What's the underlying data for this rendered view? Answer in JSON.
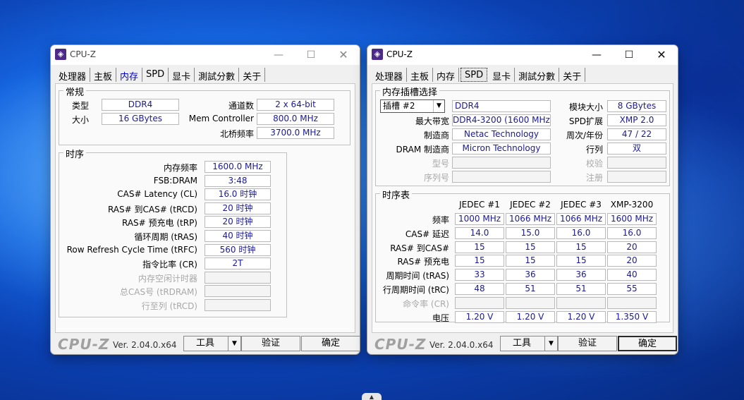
{
  "left": {
    "title": "CPU-Z",
    "tabs": [
      "处理器",
      "主板",
      "内存",
      "SPD",
      "显卡",
      "測試分數",
      "关于"
    ],
    "general": {
      "legend": "常规",
      "type_label": "类型",
      "type_value": "DDR4",
      "size_label": "大小",
      "size_value": "16 GBytes",
      "channels_label": "通道数",
      "channels_value": "2 x 64-bit",
      "memctrl_label": "Mem Controller",
      "memctrl_value": "800.0 MHz",
      "nb_label": "北桥频率",
      "nb_value": "3700.0 MHz"
    },
    "timings": {
      "legend": "时序",
      "rows": [
        {
          "label": "内存频率",
          "value": "1600.0 MHz",
          "dim": false
        },
        {
          "label": "FSB:DRAM",
          "value": "3:48",
          "dim": false
        },
        {
          "label": "CAS# Latency (CL)",
          "value": "16.0 时钟",
          "dim": false
        },
        {
          "label": "RAS# 到CAS# (tRCD)",
          "value": "20 时钟",
          "dim": false
        },
        {
          "label": "RAS# 预充电 (tRP)",
          "value": "20 时钟",
          "dim": false
        },
        {
          "label": "循环周期 (tRAS)",
          "value": "40 时钟",
          "dim": false
        },
        {
          "label": "Row Refresh Cycle Time (tRFC)",
          "value": "560 时钟",
          "dim": false
        },
        {
          "label": "指令比率 (CR)",
          "value": "2T",
          "dim": false
        },
        {
          "label": "内存空闲计时器",
          "value": "",
          "dim": true
        },
        {
          "label": "总CAS号 (tRDRAM)",
          "value": "",
          "dim": true
        },
        {
          "label": "行至列 (tRCD)",
          "value": "",
          "dim": true
        }
      ]
    },
    "bottom": {
      "brand": "CPU-Z",
      "version": "Ver. 2.04.0.x64",
      "tools": "工具",
      "validate": "验证",
      "ok": "确定"
    }
  },
  "right": {
    "title": "CPU-Z",
    "tabs": [
      "处理器",
      "主板",
      "内存",
      "SPD",
      "显卡",
      "測試分數",
      "关于"
    ],
    "slot": {
      "legend": "内存插槽选择",
      "slot_value": "插槽 #2",
      "type_value": "DDR4",
      "module_size_label": "模块大小",
      "module_size_value": "8 GBytes",
      "bandwidth_label": "最大带宽",
      "bandwidth_value": "DDR4-3200 (1600 MHz)",
      "spd_ext_label": "SPD扩展",
      "spd_ext_value": "XMP 2.0",
      "maker_label": "制造商",
      "maker_value": "Netac Technology",
      "weekyear_label": "周次/年份",
      "weekyear_value": "47 / 22",
      "dram_maker_label": "DRAM 制造商",
      "dram_maker_value": "Micron Technology",
      "ranks_label": "行列",
      "ranks_value": "双",
      "part_label": "型号",
      "part_value": "",
      "correction_label": "校验",
      "correction_value": "",
      "serial_label": "序列号",
      "serial_value": "",
      "registered_label": "注册",
      "registered_value": ""
    },
    "timing_table": {
      "legend": "时序表",
      "columns": [
        "JEDEC #1",
        "JEDEC #2",
        "JEDEC #3",
        "XMP-3200"
      ],
      "rows": [
        {
          "label": "频率",
          "values": [
            "1000 MHz",
            "1066 MHz",
            "1066 MHz",
            "1600 MHz"
          ],
          "dim": false
        },
        {
          "label": "CAS# 延迟",
          "values": [
            "14.0",
            "15.0",
            "16.0",
            "16.0"
          ],
          "dim": false
        },
        {
          "label": "RAS# 到CAS#",
          "values": [
            "15",
            "15",
            "15",
            "20"
          ],
          "dim": false
        },
        {
          "label": "RAS# 预充电",
          "values": [
            "15",
            "15",
            "15",
            "20"
          ],
          "dim": false
        },
        {
          "label": "周期时间 (tRAS)",
          "values": [
            "33",
            "36",
            "36",
            "40"
          ],
          "dim": false
        },
        {
          "label": "行周期时间 (tRC)",
          "values": [
            "48",
            "51",
            "51",
            "55"
          ],
          "dim": false
        },
        {
          "label": "命令率 (CR)",
          "values": [
            "",
            "",
            "",
            ""
          ],
          "dim": true
        },
        {
          "label": "电压",
          "values": [
            "1.20 V",
            "1.20 V",
            "1.20 V",
            "1.350 V"
          ],
          "dim": false
        }
      ]
    },
    "bottom": {
      "brand": "CPU-Z",
      "version": "Ver. 2.04.0.x64",
      "tools": "工具",
      "validate": "验证",
      "ok": "确定"
    }
  }
}
